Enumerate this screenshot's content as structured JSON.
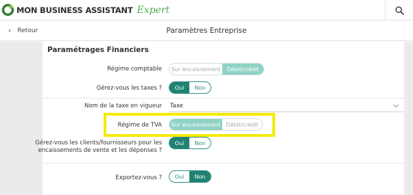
{
  "header": {
    "logo_text": "MON BUSINESS ASSISTANT",
    "logo_expert": "Expert",
    "search_icon": "search-icon"
  },
  "subheader": {
    "back_label": "Retour",
    "title": "Paramètres Entreprise"
  },
  "section": {
    "title": "Paramétrages Financiers"
  },
  "rows": {
    "regime_comptable": {
      "label": "Régime comptable",
      "options": [
        "Sur encaissement",
        "Débit/crédit"
      ],
      "selected": "Débit/crédit"
    },
    "taxes": {
      "label": "Gérez-vous les taxes ?",
      "options": [
        "Oui",
        "Non"
      ],
      "selected": "Oui"
    },
    "tax_name": {
      "label": "Nom de la taxe en vigueur",
      "value": "Taxe"
    },
    "regime_tva": {
      "label": "Régime de TVA",
      "options": [
        "Sur encaissement",
        "Débit/crédit"
      ],
      "selected": "Sur encaissement"
    },
    "clients": {
      "label": "Gérez-vous les clients/fournisseurs pour les encaissements de vente et les dépenses ?",
      "options": [
        "Oui",
        "Non"
      ],
      "selected": "Oui"
    },
    "export": {
      "label": "Exportez-vous ?",
      "options": [
        "Oui",
        "Non"
      ],
      "selected": "Non"
    }
  },
  "colors": {
    "accent": "#1f8273",
    "accent_light": "#8fd3c4",
    "highlight": "#f5ea00",
    "brand_green": "#4caf50"
  }
}
